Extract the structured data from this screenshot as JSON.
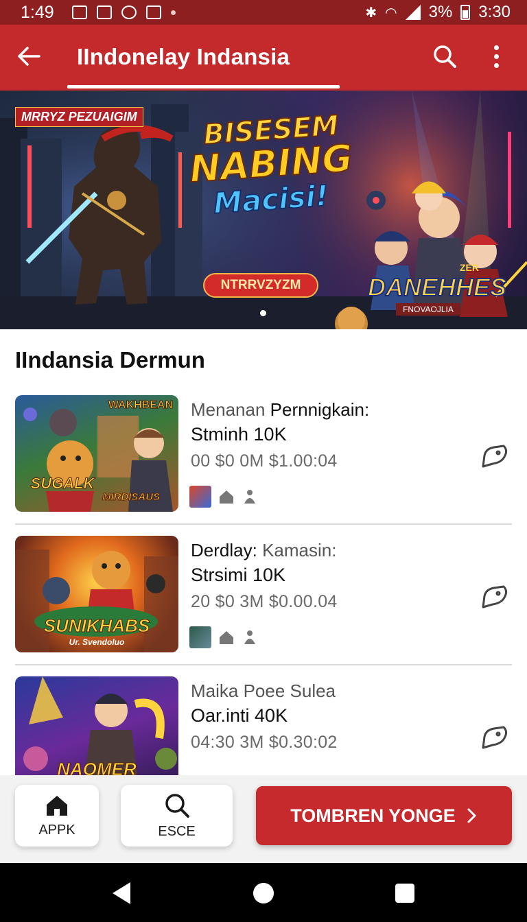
{
  "status_bar": {
    "time_left": "1:49",
    "battery_pct": "3%",
    "time_right": "3:30"
  },
  "app_bar": {
    "title": "IIndonelay Indansia",
    "back_icon": "arrow-back-icon",
    "search_icon": "search-icon",
    "more_icon": "more-vert-icon"
  },
  "banner": {
    "tag": "MRRYZ PEZUAIGIM",
    "headline_1": "BISESEM",
    "headline_2": "NABING",
    "headline_3": "Macisi!",
    "cta": "NTRRVZYZM",
    "logo_small": "ZER",
    "logo_big": "DANEHHES",
    "logo_sub": "FNOVAOJLIA",
    "page_indicator": "1"
  },
  "section": {
    "title": "IIndansia Dermun"
  },
  "items": [
    {
      "thumb_top": "WAKHBEAN",
      "thumb_caption": "SUGALK",
      "thumb_caption_right": "MIRDISAUS",
      "line1_a": "Menanan",
      "line1_b": "Pernnigkain:",
      "line2": "Stminh 10K",
      "line3": "00 $0 0M  $1.00:04"
    },
    {
      "thumb_top": "",
      "thumb_caption": "SUNIKHABS",
      "thumb_caption_right": "Ur. Svendoluo",
      "line1_a": "Derdlay:",
      "line1_b": "Kamasin:",
      "line2": "Strsimi 10K",
      "line3": "20 $0 3M  $0.00.04"
    },
    {
      "thumb_top": "",
      "thumb_caption": "NAOMER",
      "thumb_caption_right": "",
      "line1_a": "Maika Poee Sulea",
      "line1_b": "",
      "line2": "Oar.inti 40K",
      "line3": "04:30 3M  $0.30:02"
    }
  ],
  "bottom_bar": {
    "home_label": "APPK",
    "search_label": "ESCE",
    "cta_label": "TOMBREN YONGE",
    "cta_icon": "chevron-right-icon"
  },
  "colors": {
    "primary": "#c42a2c",
    "status_bar": "#8e1f21",
    "accent_gold": "#ffd43c"
  }
}
